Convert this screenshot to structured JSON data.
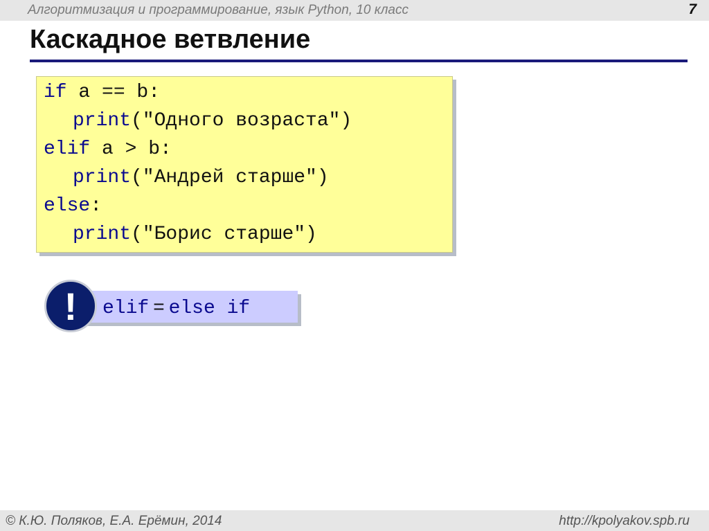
{
  "header": {
    "course": "Алгоритмизация и программирование, язык Python, 10 класс",
    "slide_number": "7"
  },
  "slide": {
    "title": "Каскадное ветвление"
  },
  "code": {
    "line1": {
      "kw": "if",
      "rest": " a == b:"
    },
    "line2": {
      "call": "print",
      "arg": "(\"Одного возраста\")"
    },
    "line3": {
      "kw": "elif",
      "rest": " a > b:"
    },
    "line4": {
      "call": "print",
      "arg": "(\"Андрей старше\")"
    },
    "line5": {
      "kw": "else",
      "rest": ":"
    },
    "line6": {
      "call": "print",
      "arg": "(\"Борис старше\")"
    }
  },
  "note": {
    "badge": "!",
    "left": "elif",
    "equals": "=",
    "right": "else if"
  },
  "footer": {
    "authors": "© К.Ю. Поляков, Е.А. Ерёмин, 2014",
    "url": "http://kpolyakov.spb.ru"
  },
  "colors": {
    "code_background": "#ffff99",
    "keyword": "#0a0a8f",
    "title_rule": "#1a1a7a",
    "note_background": "#ccccff",
    "badge": "#0b1e6b"
  }
}
